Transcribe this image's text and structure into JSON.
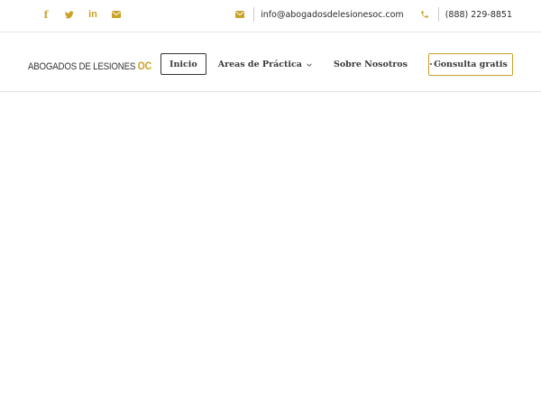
{
  "topbar": {
    "social": [
      {
        "name": "facebook",
        "icon": "facebook-icon",
        "glyph": "f"
      },
      {
        "name": "twitter",
        "icon": "twitter-icon",
        "glyph": ""
      },
      {
        "name": "linkedin",
        "icon": "linkedin-icon",
        "glyph": "in"
      },
      {
        "name": "email",
        "icon": "envelope-icon",
        "glyph": ""
      }
    ],
    "email": "info@abogadosdelesionesoc.com",
    "phone": "(888) 229-8851"
  },
  "logo": {
    "main": "ABOGADOS DE LESIONES",
    "accent": "OC"
  },
  "nav": {
    "items": [
      {
        "label": "Inicio",
        "active": true
      },
      {
        "label": "Areas de Práctica",
        "has_dropdown": true
      },
      {
        "label": "Sobre Nosotros"
      },
      {
        "label": "···"
      }
    ],
    "cta": "Consulta gratis"
  },
  "colors": {
    "accent": "#c9a227",
    "text": "#3a3a3a",
    "border": "#e3e3e3"
  }
}
